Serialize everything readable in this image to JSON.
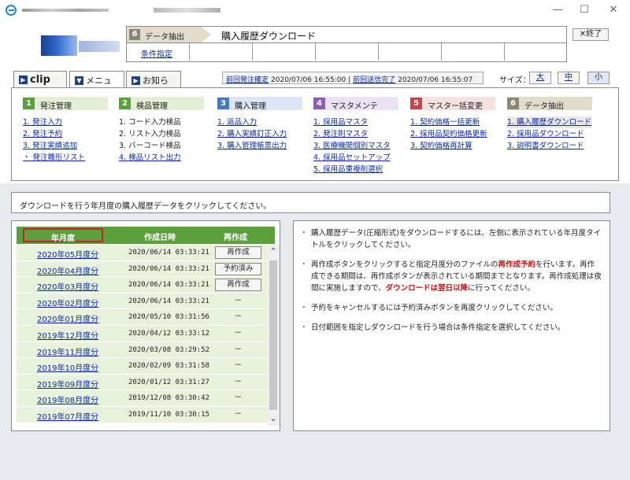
{
  "window": {
    "minimize": "—",
    "maximize": "☐",
    "close": "✕"
  },
  "header": {
    "step_num": "6",
    "step_label": "データ抽出",
    "page_title": "購入履歴ダウンロード",
    "cond_link": "条件指定",
    "close_button": "✕終了"
  },
  "tabs": [
    {
      "label": "clip",
      "icon": "arrow-right-icon"
    },
    {
      "label": "メニュー",
      "icon": "arrow-down-icon"
    },
    {
      "label": "お知らせ",
      "icon": "arrow-right-icon"
    }
  ],
  "status": {
    "prev_order_label": "前回発注確定",
    "prev_order_time": "2020/07/06 16:55:00",
    "sep": "|",
    "prev_send_label": "前回送信完了",
    "prev_send_time": "2020/07/06 16:55:07"
  },
  "size": {
    "label": "サイズ：",
    "options": [
      "大",
      "中",
      "小"
    ],
    "selected": "小"
  },
  "menu": [
    {
      "num": "1",
      "title": "発注管理",
      "color": "#5ba03d",
      "bg": "#e3efd7",
      "items": [
        "1. 発注入力",
        "2. 発注予約",
        "3. 発注実績追加",
        "・ 発注雛形リスト"
      ]
    },
    {
      "num": "2",
      "title": "検品管理",
      "color": "#5ba03d",
      "bg": "#e3efd7",
      "items": [
        "1. コード入力検品",
        "2. リスト入力検品",
        "3. バーコード検品",
        "4. 検品リスト出力"
      ]
    },
    {
      "num": "3",
      "title": "購入管理",
      "color": "#4a78bf",
      "bg": "#dde6f5",
      "items": [
        "1. 返品入力",
        "2. 購入実績訂正入力",
        "3. 購入管理帳票出力"
      ]
    },
    {
      "num": "4",
      "title": "マスタメンテ",
      "color": "#8a5fb0",
      "bg": "#ebe2f3",
      "items": [
        "1. 採用品マスタ",
        "2. 発注則マスタ",
        "3. 医療機関個別マスタ",
        "4. 採用品セットアップ",
        "5. 採用品重複削選択"
      ]
    },
    {
      "num": "5",
      "title": "マスター括変更",
      "color": "#c9434b",
      "bg": "#f6e1e1",
      "items": [
        "1. 契約価格一括更新",
        "2. 採用品契約価格更新",
        "3. 契約価格再計算"
      ]
    },
    {
      "num": "6",
      "title": "データ抽出",
      "color": "#8e8676",
      "bg": "#e2dccd",
      "items": [
        "1. 購入履歴ダウンロード",
        "2. 採用品ダウンロード",
        "3. 説明書ダウンロード"
      ]
    }
  ],
  "instruction": "ダウンロードを行う年月度の購入履歴データをクリックしてください。",
  "table": {
    "headers": [
      "年月度",
      "作成日時",
      "再作成"
    ],
    "rows": [
      {
        "ym": "2020年05月度分",
        "dt": "2020/06/14 03:33:21",
        "act": "再作成",
        "type": "button"
      },
      {
        "ym": "2020年04月度分",
        "dt": "2020/06/14 03:33:21",
        "act": "予約済み",
        "type": "button"
      },
      {
        "ym": "2020年03月度分",
        "dt": "2020/06/14 03:33:21",
        "act": "再作成",
        "type": "button"
      },
      {
        "ym": "2020年02月度分",
        "dt": "2020/06/14 03:33:21",
        "act": "－",
        "type": "dash"
      },
      {
        "ym": "2020年01月度分",
        "dt": "2020/05/10 03:31:56",
        "act": "－",
        "type": "dash"
      },
      {
        "ym": "2019年12月度分",
        "dt": "2020/04/12 03:33:12",
        "act": "－",
        "type": "dash"
      },
      {
        "ym": "2019年11月度分",
        "dt": "2020/03/08 03:29:52",
        "act": "－",
        "type": "dash"
      },
      {
        "ym": "2019年10月度分",
        "dt": "2020/02/09 03:31:58",
        "act": "－",
        "type": "dash"
      },
      {
        "ym": "2019年09月度分",
        "dt": "2020/01/12 03:31:27",
        "act": "－",
        "type": "dash"
      },
      {
        "ym": "2019年08月度分",
        "dt": "2019/12/08 03:30:42",
        "act": "－",
        "type": "dash"
      },
      {
        "ym": "2019年07月度分",
        "dt": "2019/11/10 03:30:15",
        "act": "－",
        "type": "dash"
      }
    ]
  },
  "info": {
    "p1": "購入履歴データ(圧縮形式)をダウンロードするには、左側に表示されている年月度タイトルをクリックしてください。",
    "p2a": "再作成ボタンをクリックすると指定月度分のファイルの",
    "p2b": "再作成予約",
    "p2c": "を行います。再作成できる期間は、再作成ボタンが表示されている期間までとなります。再作成処理は夜間に実施しますので、",
    "p2d": "ダウンロードは翌日以降",
    "p2e": "に行ってください。",
    "p3": "予約をキャンセルするには予約済みボタンを再度クリックしてください。",
    "p4": "日付範囲を指定しダウンロードを行う場合は条件指定を選択してください。"
  }
}
